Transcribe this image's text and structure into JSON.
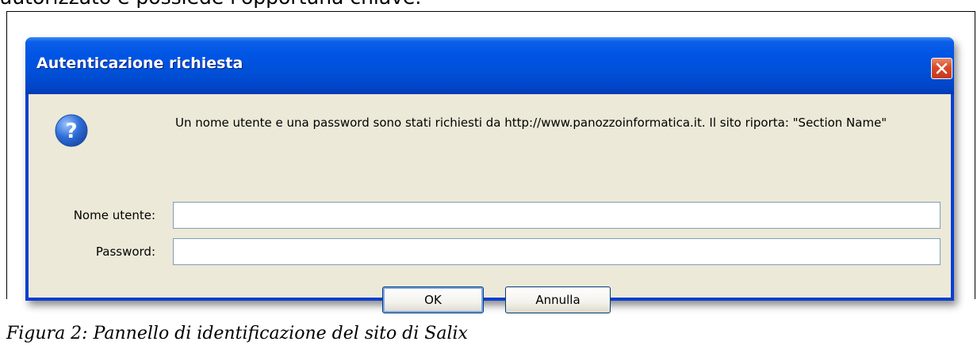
{
  "document": {
    "top_text": "autorizzato e possiede l'opportuna chiave.",
    "caption": "Figura 2: Pannello di identificazione del sito di Salix"
  },
  "dialog": {
    "title": "Autenticazione richiesta",
    "message": "Un nome utente e una password sono stati richiesti da http://www.panozzoinformatica.it. Il sito riporta: \"Section Name\"",
    "icon": "question-icon",
    "fields": {
      "username_label": "Nome utente:",
      "username_value": "",
      "password_label": "Password:",
      "password_value": ""
    },
    "buttons": {
      "ok_label": "OK",
      "cancel_label": "Annulla"
    },
    "colors": {
      "titlebar": "#0055e5",
      "client": "#ece9d8",
      "close_button": "#d8482a",
      "question_icon": "#2f6ed8"
    }
  }
}
